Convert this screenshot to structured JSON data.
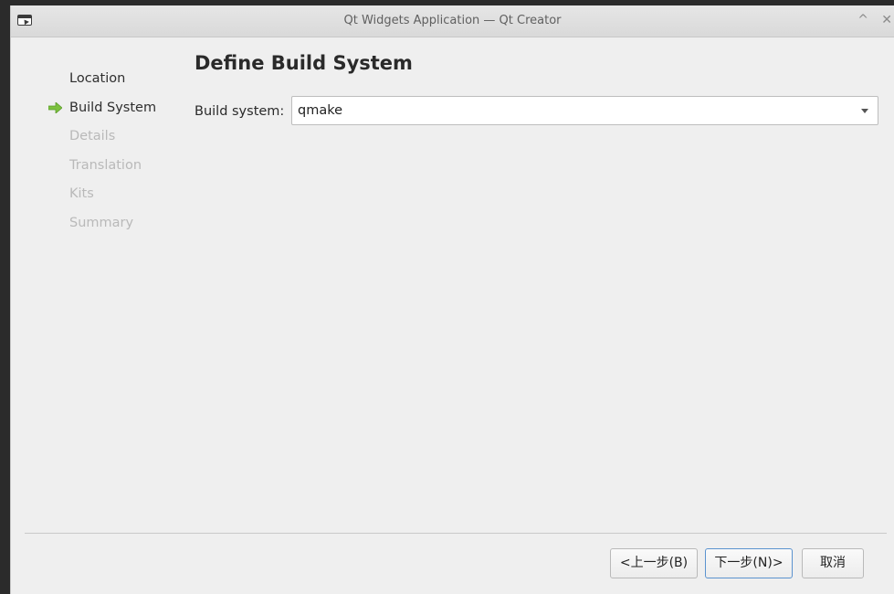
{
  "window": {
    "title": "Qt Widgets Application — Qt Creator",
    "shade_glyph": "^",
    "close_glyph": "✕"
  },
  "steps": [
    {
      "label": "Location",
      "state": "completed"
    },
    {
      "label": "Build System",
      "state": "current",
      "icon": "green-arrow-icon"
    },
    {
      "label": "Details",
      "state": "pending"
    },
    {
      "label": "Translation",
      "state": "pending"
    },
    {
      "label": "Kits",
      "state": "pending"
    },
    {
      "label": "Summary",
      "state": "pending"
    }
  ],
  "page": {
    "title": "Define Build System",
    "build_system_label": "Build system:",
    "build_system_value": "qmake"
  },
  "buttons": {
    "back": "<上一步(B)",
    "next": "下一步(N)>",
    "cancel": "取消"
  },
  "colors": {
    "current_arrow": "#7cc13e",
    "inactive_text": "#b9b9b9",
    "default_button_border": "#5b93cf"
  }
}
